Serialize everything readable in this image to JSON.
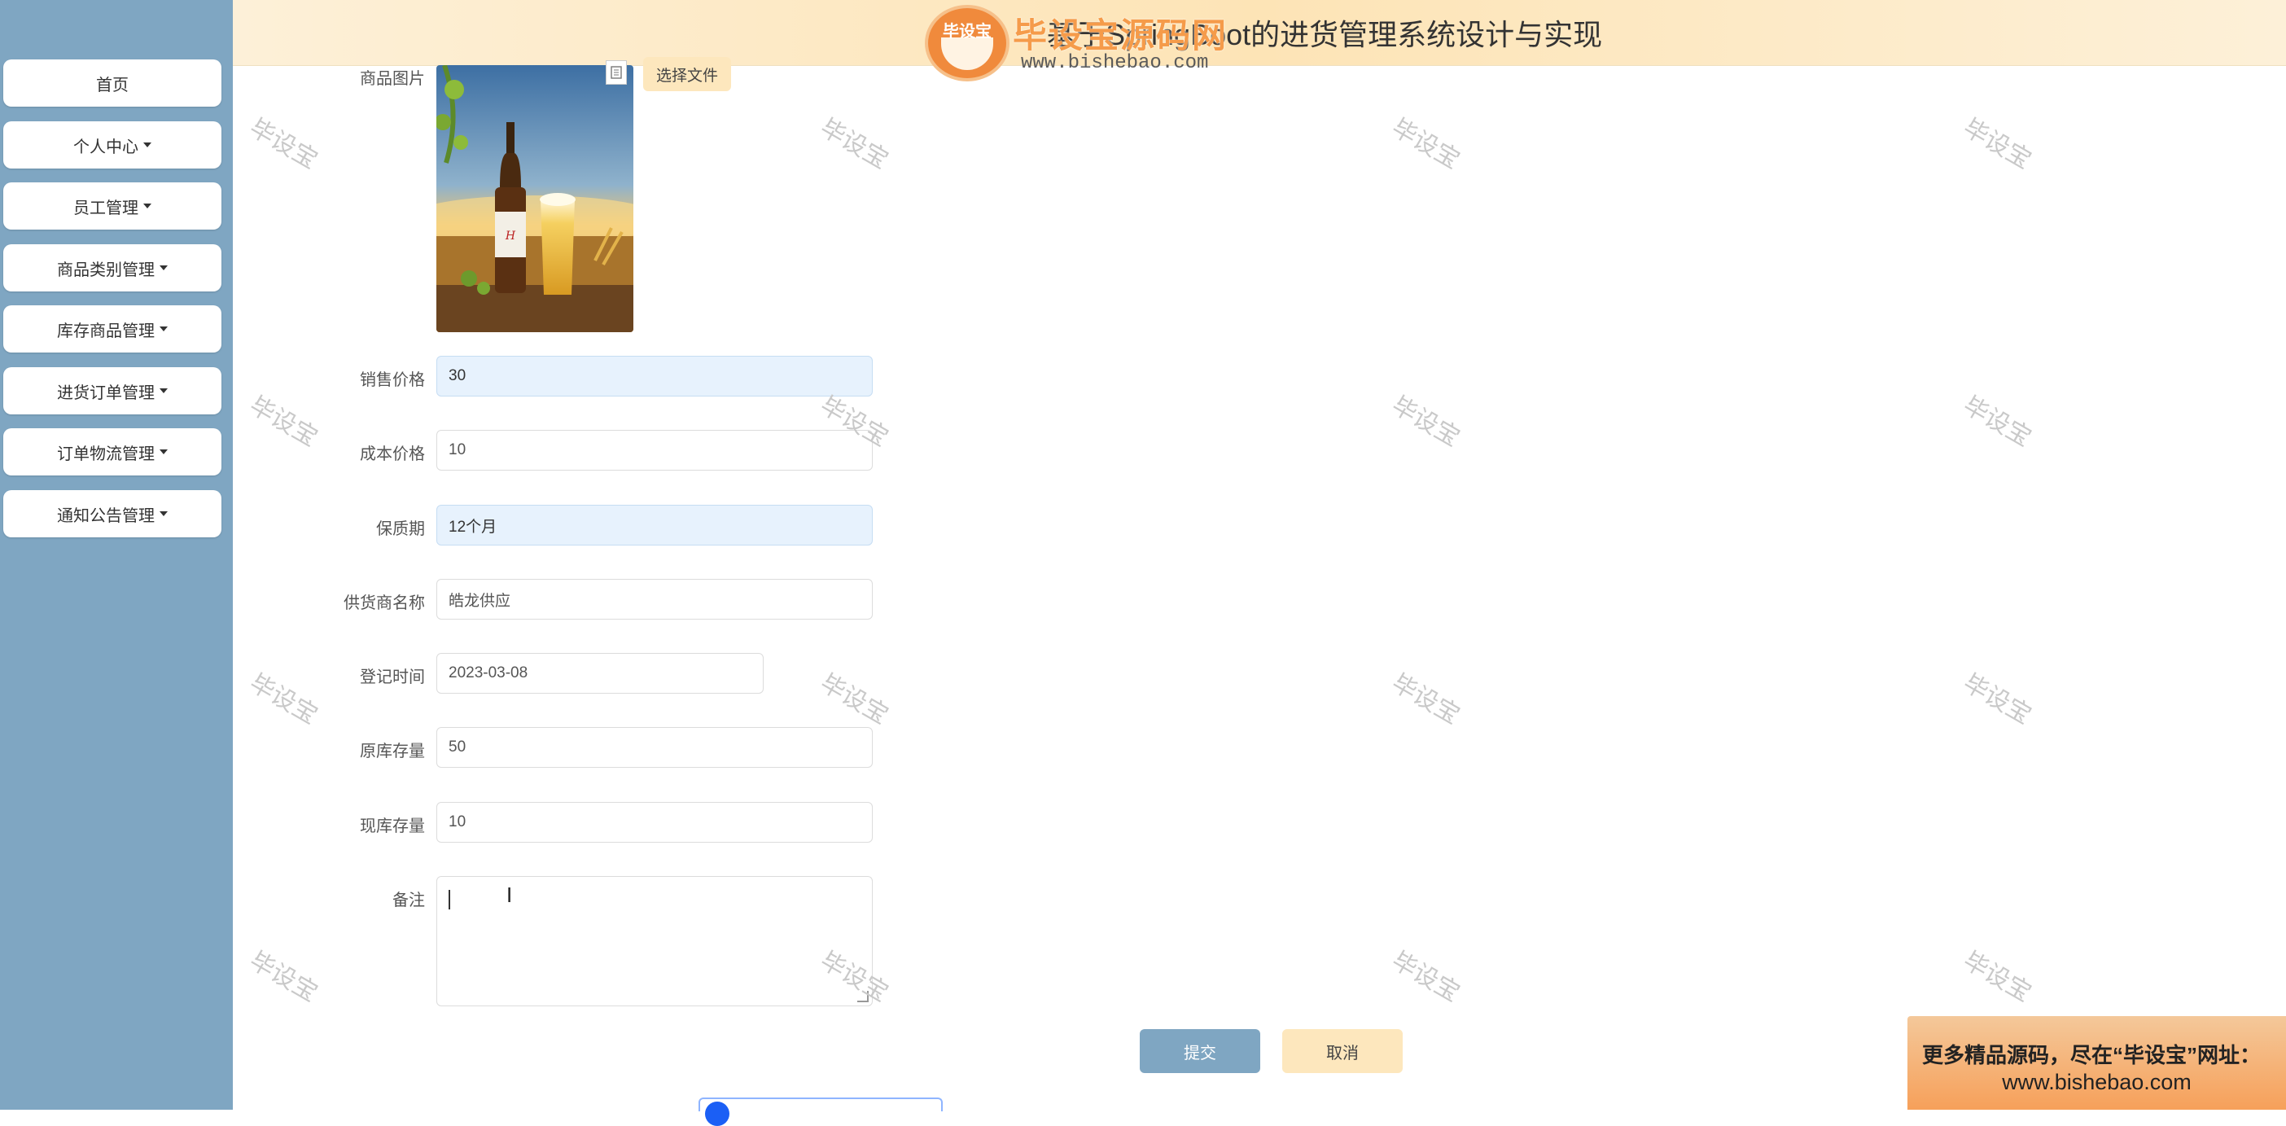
{
  "header": {
    "title": "基于SpringBoot的进货管理系统设计与实现",
    "logo_badge": "毕设宝",
    "logo_text": "毕设宝源码网",
    "logo_url": "www.bishebao.com"
  },
  "sidebar": {
    "items": [
      {
        "label": "首页",
        "dropdown": false
      },
      {
        "label": "个人中心",
        "dropdown": true
      },
      {
        "label": "员工管理",
        "dropdown": true
      },
      {
        "label": "商品类别管理",
        "dropdown": true
      },
      {
        "label": "库存商品管理",
        "dropdown": true
      },
      {
        "label": "进货订单管理",
        "dropdown": true
      },
      {
        "label": "订单物流管理",
        "dropdown": true
      },
      {
        "label": "通知公告管理",
        "dropdown": true
      }
    ]
  },
  "form": {
    "image_label": "商品图片",
    "choose_file": "选择文件",
    "sale_price": {
      "label": "销售价格",
      "value": "30"
    },
    "cost_price": {
      "label": "成本价格",
      "value": "10"
    },
    "shelf_life": {
      "label": "保质期",
      "value": "12个月"
    },
    "supplier": {
      "label": "供货商名称",
      "value": "皓龙供应"
    },
    "register_time": {
      "label": "登记时间",
      "value": "2023-03-08"
    },
    "original_stock": {
      "label": "原库存量",
      "value": "50"
    },
    "current_stock": {
      "label": "现库存量",
      "value": "10"
    },
    "remark": {
      "label": "备注",
      "value": ""
    }
  },
  "buttons": {
    "submit": "提交",
    "cancel": "取消"
  },
  "watermark_text": "毕设宝",
  "promo": {
    "line1": "更多精品源码，尽在“毕设宝”网址：",
    "line2": "www.bishebao.com"
  },
  "colors": {
    "sidebar": "#7fa6c2",
    "submit": "#7fa6c2",
    "cancel": "#fde7bd",
    "highlight_field": "#e7f2fd"
  }
}
